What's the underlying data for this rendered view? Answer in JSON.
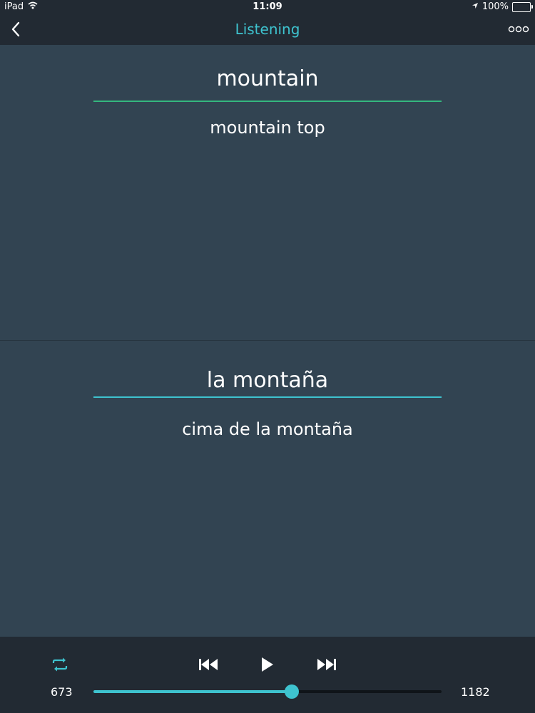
{
  "status_bar": {
    "device": "iPad",
    "time": "11:09",
    "battery": "100%",
    "icons": [
      "wifi-icon",
      "location-arrow-icon",
      "battery-icon"
    ]
  },
  "nav": {
    "title": "Listening",
    "back_icon": "chevron-left-icon",
    "more_icon": "more-dots-icon"
  },
  "cards": {
    "source": {
      "word": "mountain",
      "phrase": "mountain top"
    },
    "target": {
      "word": "la montaña",
      "phrase": "cima de la montaña"
    }
  },
  "player": {
    "position": "673",
    "total": "1182",
    "progress_fraction": 0.569,
    "controls": [
      "repeat-icon",
      "rewind-icon",
      "play-icon",
      "fast-forward-icon"
    ]
  },
  "colors": {
    "accent": "#3ec3cf",
    "source_rule": "#34b77e",
    "background": "#324452",
    "bar": "#222a33"
  }
}
